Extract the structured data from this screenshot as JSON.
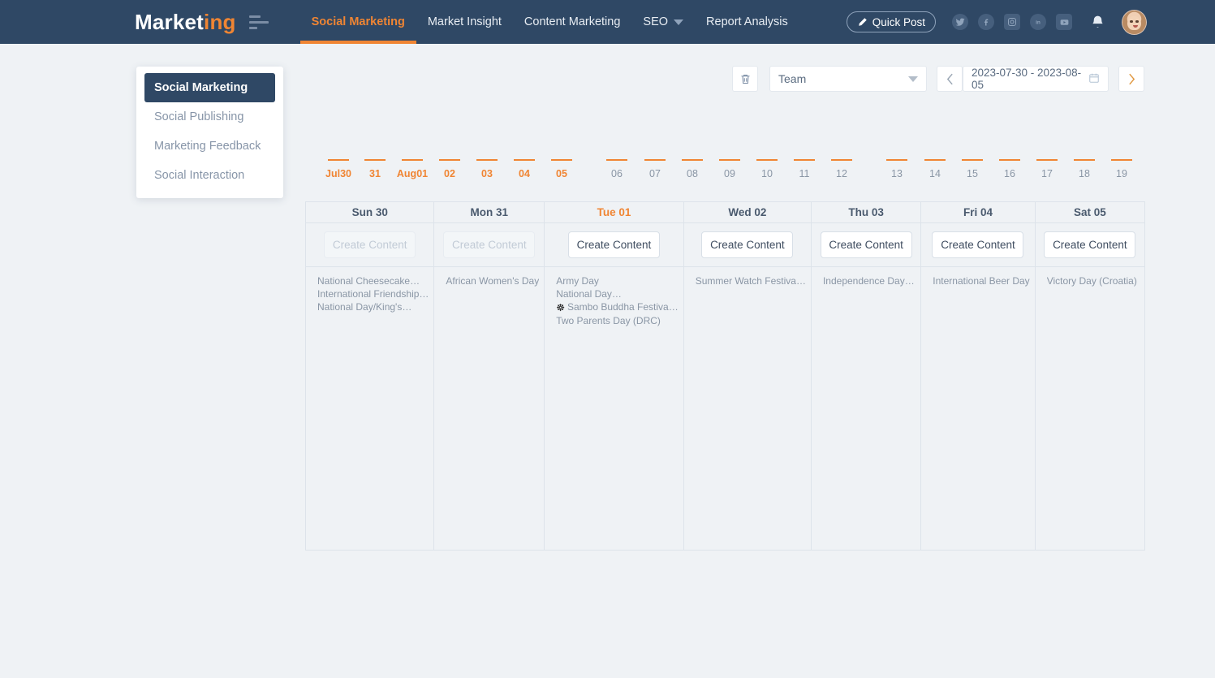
{
  "brand": {
    "text_main": "Market",
    "text_accent": "ing"
  },
  "nav": {
    "items": [
      {
        "label": "Social Marketing",
        "active": true,
        "caret": false
      },
      {
        "label": "Market Insight",
        "active": false,
        "caret": false
      },
      {
        "label": "Content Marketing",
        "active": false,
        "caret": false
      },
      {
        "label": "SEO",
        "active": false,
        "caret": true
      },
      {
        "label": "Report Analysis",
        "active": false,
        "caret": false
      }
    ]
  },
  "header_actions": {
    "quick_post_label": "Quick Post",
    "quick_post_icon": "pencil-icon",
    "social_icons": [
      "twitter-icon",
      "facebook-icon",
      "instagram-icon",
      "linkedin-icon",
      "youtube-icon"
    ],
    "notification_icon": "bell-icon",
    "avatar_icon": "user-avatar"
  },
  "dropdown": {
    "items": [
      {
        "label": "Social Marketing",
        "active": true
      },
      {
        "label": "Social Publishing",
        "active": false
      },
      {
        "label": "Marketing Feedback",
        "active": false
      },
      {
        "label": "Social Interaction",
        "active": false
      }
    ]
  },
  "toolbar": {
    "delete_icon": "trash-icon",
    "team_select_value": "Team",
    "prev_icon": "chevron-left-icon",
    "date_range": "2023-07-30 - 2023-08-05",
    "calendar_icon": "calendar-icon",
    "next_icon": "chevron-right-icon"
  },
  "timeline": {
    "ticks": [
      {
        "label": "Jul30",
        "selected": true
      },
      {
        "label": "31",
        "selected": true
      },
      {
        "label": "Aug01",
        "selected": true
      },
      {
        "label": "02",
        "selected": true
      },
      {
        "label": "03",
        "selected": true
      },
      {
        "label": "04",
        "selected": true
      },
      {
        "label": "05",
        "selected": true
      },
      {
        "label": "06",
        "selected": false
      },
      {
        "label": "07",
        "selected": false
      },
      {
        "label": "08",
        "selected": false
      },
      {
        "label": "09",
        "selected": false
      },
      {
        "label": "10",
        "selected": false
      },
      {
        "label": "11",
        "selected": false
      },
      {
        "label": "12",
        "selected": false
      },
      {
        "label": "13",
        "selected": false
      },
      {
        "label": "14",
        "selected": false
      },
      {
        "label": "15",
        "selected": false
      },
      {
        "label": "16",
        "selected": false
      },
      {
        "label": "17",
        "selected": false
      },
      {
        "label": "18",
        "selected": false
      },
      {
        "label": "19",
        "selected": false
      }
    ]
  },
  "calendar": {
    "create_label": "Create Content",
    "columns": [
      {
        "day": "Sun 30",
        "today": false,
        "create_disabled": true,
        "events": [
          {
            "text": "National Cheesecake…",
            "icon": null
          },
          {
            "text": "International Friendship…",
            "icon": null
          },
          {
            "text": "National Day/King's…",
            "icon": null
          }
        ]
      },
      {
        "day": "Mon 31",
        "today": false,
        "create_disabled": true,
        "events": [
          {
            "text": "African Women's Day",
            "icon": null
          }
        ]
      },
      {
        "day": "Tue 01",
        "today": true,
        "create_disabled": false,
        "events": [
          {
            "text": "Army Day",
            "icon": null
          },
          {
            "text": "National Day…",
            "icon": null
          },
          {
            "text": "Sambo Buddha Festiva…",
            "icon": "dharma-wheel-icon"
          },
          {
            "text": "Two Parents Day (DRC)",
            "icon": null
          }
        ]
      },
      {
        "day": "Wed 02",
        "today": false,
        "create_disabled": false,
        "events": [
          {
            "text": "Summer Watch Festiva…",
            "icon": null
          }
        ]
      },
      {
        "day": "Thu 03",
        "today": false,
        "create_disabled": false,
        "events": [
          {
            "text": "Independence Day…",
            "icon": null
          }
        ]
      },
      {
        "day": "Fri 04",
        "today": false,
        "create_disabled": false,
        "events": [
          {
            "text": "International Beer Day",
            "icon": null
          }
        ]
      },
      {
        "day": "Sat 05",
        "today": false,
        "create_disabled": false,
        "events": [
          {
            "text": "Victory Day (Croatia)",
            "icon": null
          }
        ]
      }
    ]
  },
  "colors": {
    "accent": "#f08533",
    "navy": "#2f4865",
    "background": "#eff2f5"
  }
}
